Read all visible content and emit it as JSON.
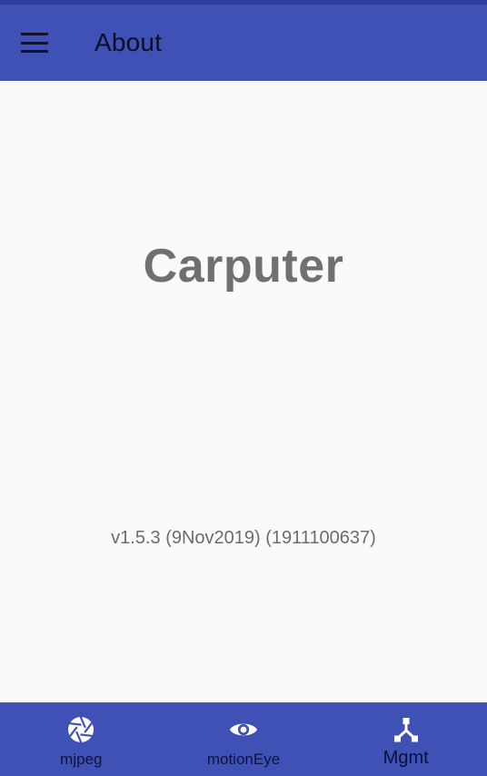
{
  "app_bar": {
    "title": "About",
    "menu_icon": "hamburger-menu-icon"
  },
  "about": {
    "product_name": "Carputer",
    "version": "v1.5.3 (9Nov2019) (1911100637)"
  },
  "bottom_nav": {
    "items": [
      {
        "label": "mjpeg",
        "icon": "camera-shutter-icon",
        "active": false
      },
      {
        "label": "motionEye",
        "icon": "eye-icon",
        "active": false
      },
      {
        "label": "Mgmt",
        "icon": "hub-network-icon",
        "active": true
      }
    ]
  },
  "colors": {
    "primary": "#3f51b5",
    "primary_dark": "#303f9f",
    "background": "#fafafa",
    "product_name_text": "#707070",
    "nav_icon": "#ffffff"
  }
}
